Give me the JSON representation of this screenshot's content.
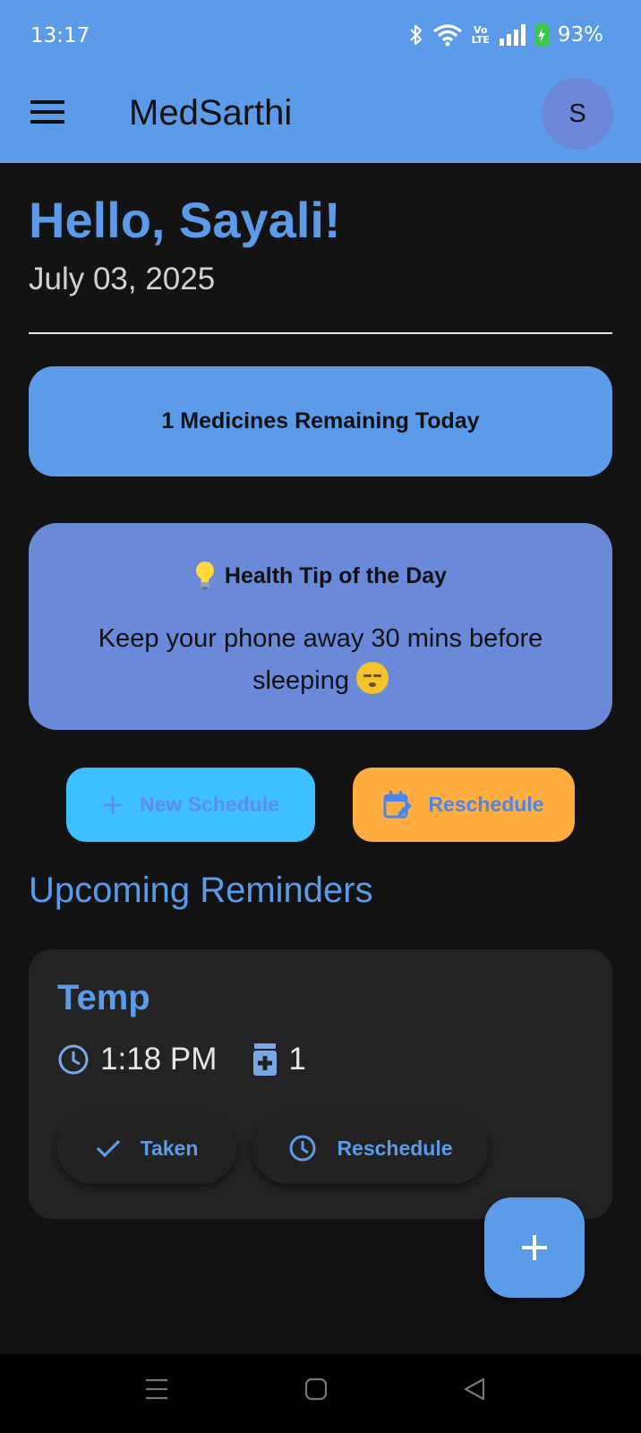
{
  "status_bar": {
    "time": "13:17",
    "volte_top": "Vo",
    "volte_bottom": "LTE",
    "battery_percent": "93%"
  },
  "app_bar": {
    "title": "MedSarthi",
    "avatar_initial": "S"
  },
  "header": {
    "greeting": "Hello, Sayali!",
    "date": "July 03, 2025"
  },
  "remaining_card": {
    "text": "1 Medicines Remaining Today"
  },
  "health_tip": {
    "title": "Health Tip of the Day",
    "text": "Keep your phone away 30 mins before sleeping"
  },
  "actions": {
    "new_schedule_label": "New Schedule",
    "reschedule_label": "Reschedule"
  },
  "upcoming": {
    "section_title": "Upcoming Reminders",
    "reminders": [
      {
        "name": "Temp",
        "time": "1:18 PM",
        "dose": "1",
        "taken_label": "Taken",
        "reschedule_label": "Reschedule"
      }
    ]
  },
  "colors": {
    "primary": "#5b9be9",
    "tip_card": "#6a89d9",
    "new_schedule_bg": "#3ebfff",
    "reschedule_bg": "#ffac40",
    "background": "#131313",
    "card": "#232323"
  }
}
